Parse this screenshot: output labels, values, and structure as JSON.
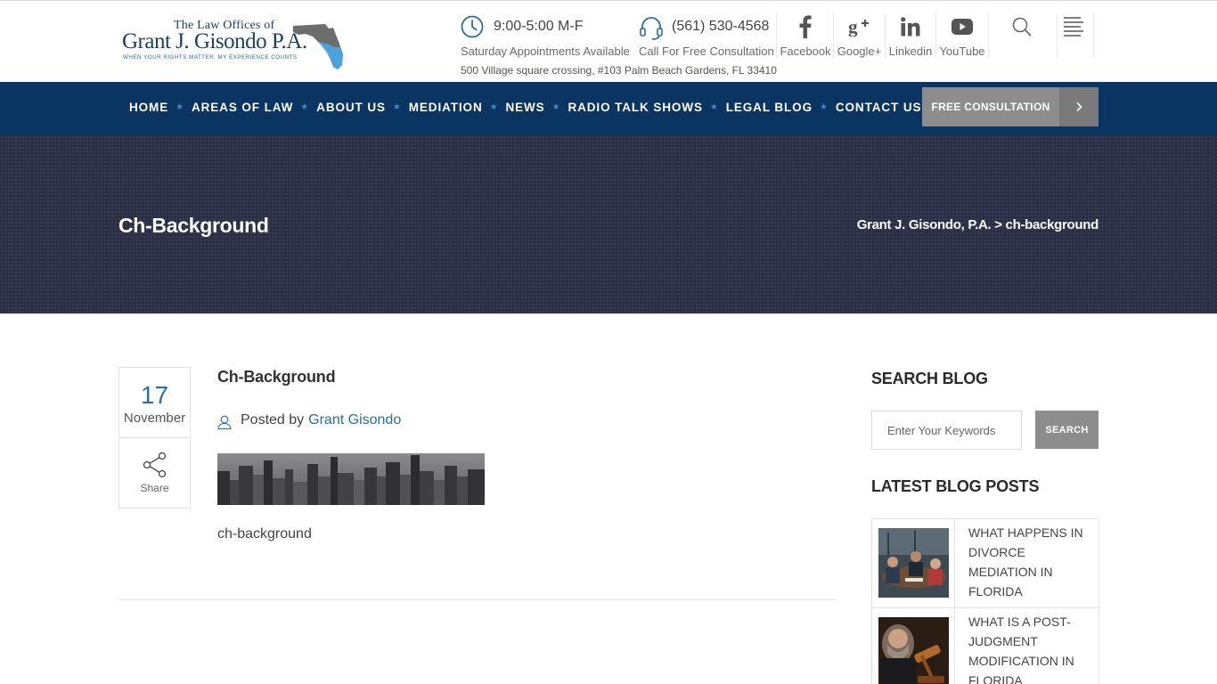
{
  "logo": {
    "line1": "The Law Offices of",
    "line2": "Grant J. Gisondo P.A.",
    "tagline": "WHEN YOUR RIGHTS MATTER, MY EXPERIENCE COUNTS"
  },
  "header": {
    "hours": {
      "main": "9:00-5:00 M-F",
      "sub": "Saturday Appointments Available",
      "icon": "clock-icon"
    },
    "phone": {
      "main": "(561) 530-4568",
      "sub": "Call For Free Consultation",
      "icon": "headset-icon"
    },
    "address": "500 Village square crossing, #103 Palm Beach Gardens, FL 33410",
    "social": [
      {
        "label": "Facebook",
        "icon": "facebook-icon"
      },
      {
        "label": "Google+",
        "icon": "google-plus-icon"
      },
      {
        "label": "Linkedin",
        "icon": "linkedin-icon"
      },
      {
        "label": "YouTube",
        "icon": "youtube-icon"
      }
    ]
  },
  "nav": {
    "items": [
      "HOME",
      "AREAS OF LAW",
      "ABOUT US",
      "MEDIATION",
      "NEWS",
      "RADIO TALK SHOWS",
      "LEGAL BLOG",
      "CONTACT US"
    ],
    "cta": "FREE CONSULTATION"
  },
  "banner": {
    "title": "Ch-Background",
    "breadcrumb": "Grant J. Gisondo, P.A. > ch-background"
  },
  "post": {
    "day": "17",
    "month": "November",
    "share": "Share",
    "title": "Ch-Background",
    "posted_by": "Posted by",
    "author": "Grant Gisondo",
    "caption": "ch-background"
  },
  "sidebar": {
    "search_heading": "SEARCH BLOG",
    "search_placeholder": "Enter Your Keywords",
    "search_button": "SEARCH",
    "latest_heading": "LATEST BLOG POSTS",
    "latest_posts": [
      {
        "title": "What Happens in Divorce Mediation in Florida"
      },
      {
        "title": "What Is a Post-Judgment Modification in Florida"
      }
    ]
  },
  "colors": {
    "nav_bg": "#0a3461",
    "banner_bg": "#2b2f45",
    "accent": "#2a6ea8",
    "button_gray": "#8d8d8d"
  }
}
